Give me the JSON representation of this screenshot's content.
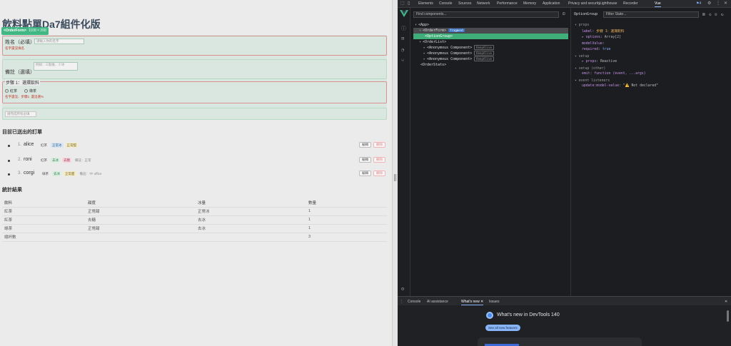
{
  "page": {
    "title": "飲料點單Da7組件化版",
    "component_badge": {
      "name": "<OrderForm>",
      "size": "1108 × 268"
    },
    "name_field": {
      "label": "姓名（必填）",
      "placeholder": "請輸入你的名字",
      "error": "名字還沒填名"
    },
    "note_field": {
      "label": "備註（選填）",
      "placeholder": "例如：三點後、少冰"
    },
    "step1": {
      "legend": "步驟 1：選擇飲料",
      "options": [
        "紅茶",
        "綠茶"
      ],
      "error": "名字還沒、步驟1: 還沒選%"
    },
    "extra_placeholder": "請完成所有必填",
    "orders_heading": "目前已送出的訂單",
    "orders": [
      {
        "idx": "1.",
        "name": "alice",
        "tags": [
          {
            "text": "紅茶",
            "style": "plain"
          },
          {
            "text": "正常冰",
            "style": "blue"
          },
          {
            "text": "正常甜",
            "style": "yellow"
          }
        ],
        "note": ""
      },
      {
        "idx": "2.",
        "name": "roni",
        "tags": [
          {
            "text": "紅茶",
            "style": "plain"
          },
          {
            "text": "去冰",
            "style": "green"
          },
          {
            "text": "去糖",
            "style": "pink"
          },
          {
            "text": "備註：正常",
            "style": "grey"
          }
        ],
        "note": ""
      },
      {
        "idx": "3.",
        "name": "corgi",
        "tags": [
          {
            "text": "綠茶",
            "style": "plain"
          },
          {
            "text": "去冰",
            "style": "green"
          },
          {
            "text": "正常甜",
            "style": "yellow"
          },
          {
            "text": "備註：TF office",
            "style": "grey"
          }
        ],
        "note": ""
      }
    ],
    "edit_label": "編輯",
    "delete_label": "刪除",
    "stats_heading": "統計結果",
    "stats_columns": [
      "飲料",
      "甜度",
      "冰量",
      "數量"
    ],
    "stats_rows": [
      [
        "紅茶",
        "正常甜",
        "正常冰",
        "1"
      ],
      [
        "紅茶",
        "去糖",
        "去冰",
        "1"
      ],
      [
        "綠茶",
        "正常甜",
        "去冰",
        "1"
      ],
      [
        "總杯數",
        "",
        "",
        "3"
      ]
    ]
  },
  "devtools": {
    "tabs": [
      "Elements",
      "Console",
      "Sources",
      "Network",
      "Performance",
      "Memory",
      "Application",
      "Privacy and security",
      "Lighthouse",
      "Recorder",
      "Vue"
    ],
    "issues_count": "4",
    "find_placeholder": "Find components...",
    "tree": [
      {
        "text": "<App>",
        "indent": 0,
        "arrow": "▾"
      },
      {
        "text": "<OrderForm>",
        "indent": 1,
        "arrow": "▾",
        "badge": "fragment",
        "badge_style": "frag",
        "state": "selected-dim"
      },
      {
        "text": "<OptionGroup>",
        "indent": 2,
        "arrow": "",
        "state": "selected"
      },
      {
        "text": "<OrderList>",
        "indent": 1,
        "arrow": "▾"
      },
      {
        "text": "<Anonymous Component>",
        "indent": 2,
        "arrow": "▸",
        "badge": "KeepAlive",
        "badge_style": "kalive"
      },
      {
        "text": "<Anonymous Component>",
        "indent": 2,
        "arrow": "▸",
        "badge": "KeepAlive",
        "badge_style": "kalive"
      },
      {
        "text": "<Anonymous Component>",
        "indent": 2,
        "arrow": "▸",
        "badge": "KeepAlive",
        "badge_style": "kalive"
      },
      {
        "text": "<OrderStats>",
        "indent": 1,
        "arrow": ""
      }
    ],
    "detail": {
      "title": "OptionGroup",
      "filter_placeholder": "Filter State...",
      "lines": [
        {
          "indent": 0,
          "parts": [
            {
              "t": "▾ props",
              "c": "sec"
            }
          ]
        },
        {
          "indent": 1,
          "parts": [
            {
              "t": "label",
              "c": "kp"
            },
            {
              "t": ": ",
              "c": "k"
            },
            {
              "t": "步驟 1：選擇飲料",
              "c": "v-str"
            }
          ]
        },
        {
          "indent": 1,
          "parts": [
            {
              "t": "▸ options",
              "c": "kp"
            },
            {
              "t": ": Array[2]",
              "c": "k"
            }
          ]
        },
        {
          "indent": 1,
          "parts": [
            {
              "t": "modelValue",
              "c": "kp"
            },
            {
              "t": ":",
              "c": "k"
            }
          ]
        },
        {
          "indent": 1,
          "parts": [
            {
              "t": "required",
              "c": "kp"
            },
            {
              "t": ": ",
              "c": "k"
            },
            {
              "t": "true",
              "c": "v-bool"
            }
          ]
        },
        {
          "indent": 0,
          "parts": [
            {
              "t": "▾ setup",
              "c": "sec"
            }
          ]
        },
        {
          "indent": 1,
          "parts": [
            {
              "t": "▸ props",
              "c": "kp"
            },
            {
              "t": ": Reactive",
              "c": "k"
            }
          ]
        },
        {
          "indent": 0,
          "parts": [
            {
              "t": "▾ setup (other)",
              "c": "sec"
            }
          ]
        },
        {
          "indent": 1,
          "parts": [
            {
              "t": "emit",
              "c": "kp"
            },
            {
              "t": ": ",
              "c": "k"
            },
            {
              "t": "function (event, ...args)",
              "c": "v-fn"
            }
          ]
        },
        {
          "indent": 0,
          "parts": [
            {
              "t": "▾ event listeners",
              "c": "sec"
            }
          ]
        },
        {
          "indent": 1,
          "parts": [
            {
              "t": "update:model-value",
              "c": "kp"
            },
            {
              "t": ": ",
              "c": "k"
            },
            {
              "t": "\"⚠️ Not declared\"",
              "c": "k"
            }
          ]
        }
      ]
    },
    "drawer": {
      "tabs": [
        "Console",
        "AI assistance",
        "What's new",
        "Issues"
      ],
      "whats_new_title": "What's new in DevTools 140",
      "see_all_label": "See all new features"
    }
  }
}
